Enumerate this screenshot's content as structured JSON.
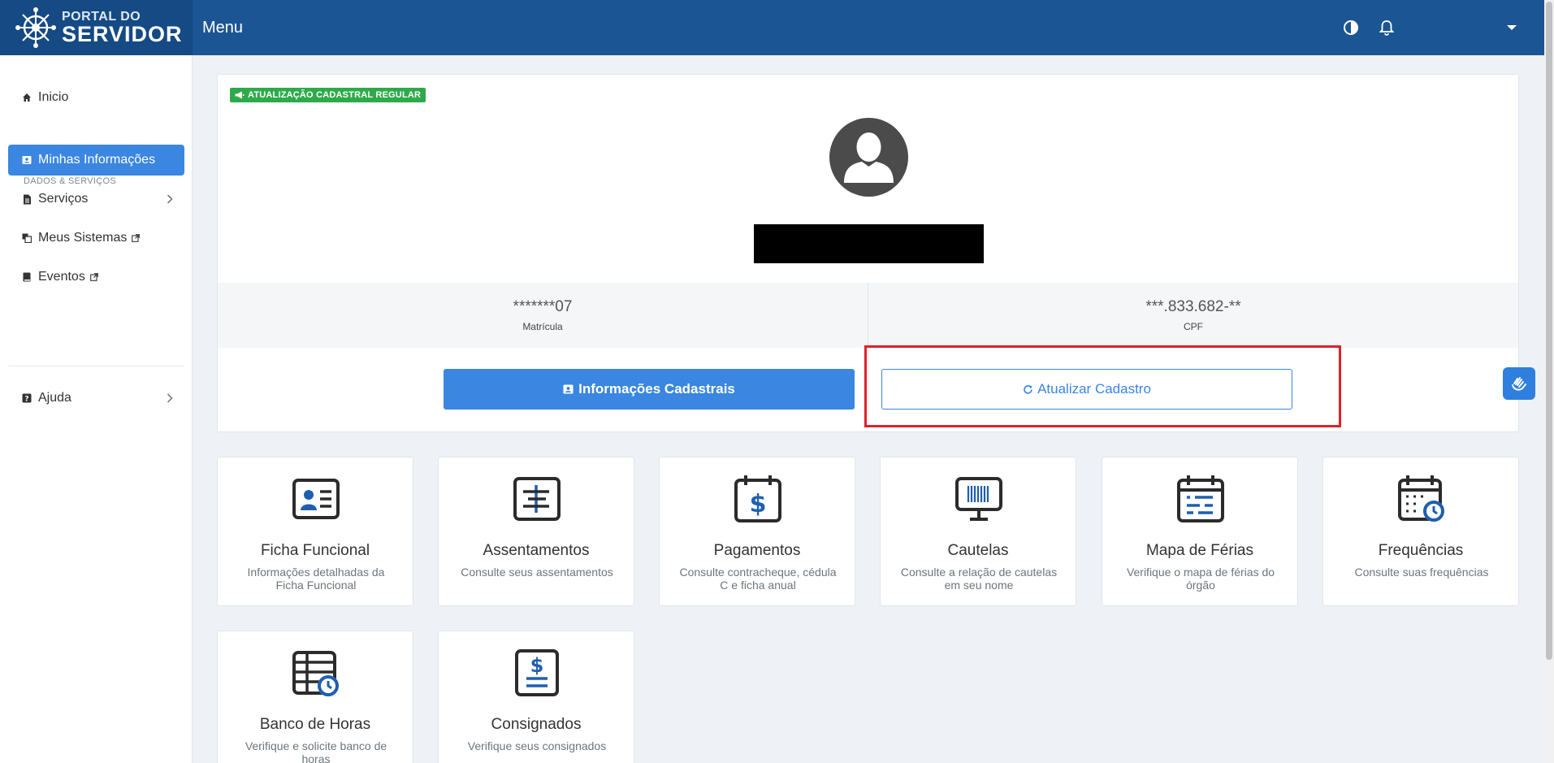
{
  "header": {
    "brand_line1": "PORTAL DO",
    "brand_line2": "SERVIDOR",
    "menu_title": "Menu",
    "icons": [
      "contrast-icon",
      "bell-icon",
      "caret-down-icon"
    ]
  },
  "sidebar": {
    "section_label": "DADOS & SERVIÇOS",
    "items": [
      {
        "label": "Inicio",
        "icon": "home-icon"
      },
      {
        "label": "Minhas Informações",
        "icon": "id-card-icon",
        "active": true
      },
      {
        "label": "Serviços",
        "icon": "document-icon",
        "has_submenu": true
      },
      {
        "label": "Meus Sistemas",
        "icon": "copy-icon",
        "external": true
      },
      {
        "label": "Eventos",
        "icon": "book-icon",
        "external": true
      },
      {
        "label": "Ajuda",
        "icon": "question-icon",
        "has_submenu": true
      }
    ]
  },
  "profile": {
    "badge": "ATUALIZAÇÃO CADASTRAL REGULAR",
    "matricula_value": "*******07",
    "matricula_label": "Matrícula",
    "cpf_value": "***.833.682-**",
    "cpf_label": "CPF",
    "info_button": "Informações Cadastrais",
    "update_button": "Atualizar Cadastro"
  },
  "tiles": [
    {
      "title": "Ficha Funcional",
      "desc": "Informações detalhadas da Ficha Funcional",
      "icon": "id-card-icon"
    },
    {
      "title": "Assentamentos",
      "desc": "Consulte seus assentamentos",
      "icon": "timeline-icon"
    },
    {
      "title": "Pagamentos",
      "desc": "Consulte contracheque, cédula C e ficha anual",
      "icon": "calendar-dollar-icon"
    },
    {
      "title": "Cautelas",
      "desc": "Consulte a relação de cautelas em seu nome",
      "icon": "barcode-monitor-icon"
    },
    {
      "title": "Mapa de Férias",
      "desc": "Verifique o mapa de férias do órgão",
      "icon": "calendar-list-icon"
    },
    {
      "title": "Frequências",
      "desc": "Consulte suas frequências",
      "icon": "calendar-clock-icon"
    },
    {
      "title": "Banco de Horas",
      "desc": "Verifique e solicite banco de horas",
      "icon": "table-clock-icon"
    },
    {
      "title": "Consignados",
      "desc": "Verifique seus consignados",
      "icon": "dollar-document-icon"
    }
  ],
  "colors": {
    "header_bg": "#1b5593",
    "primary": "#3a86e0",
    "badge_green": "#2eaa4b",
    "highlight_red": "#e0202a",
    "icon_dark": "#2b2b2b",
    "icon_accent": "#1f5fb0"
  }
}
